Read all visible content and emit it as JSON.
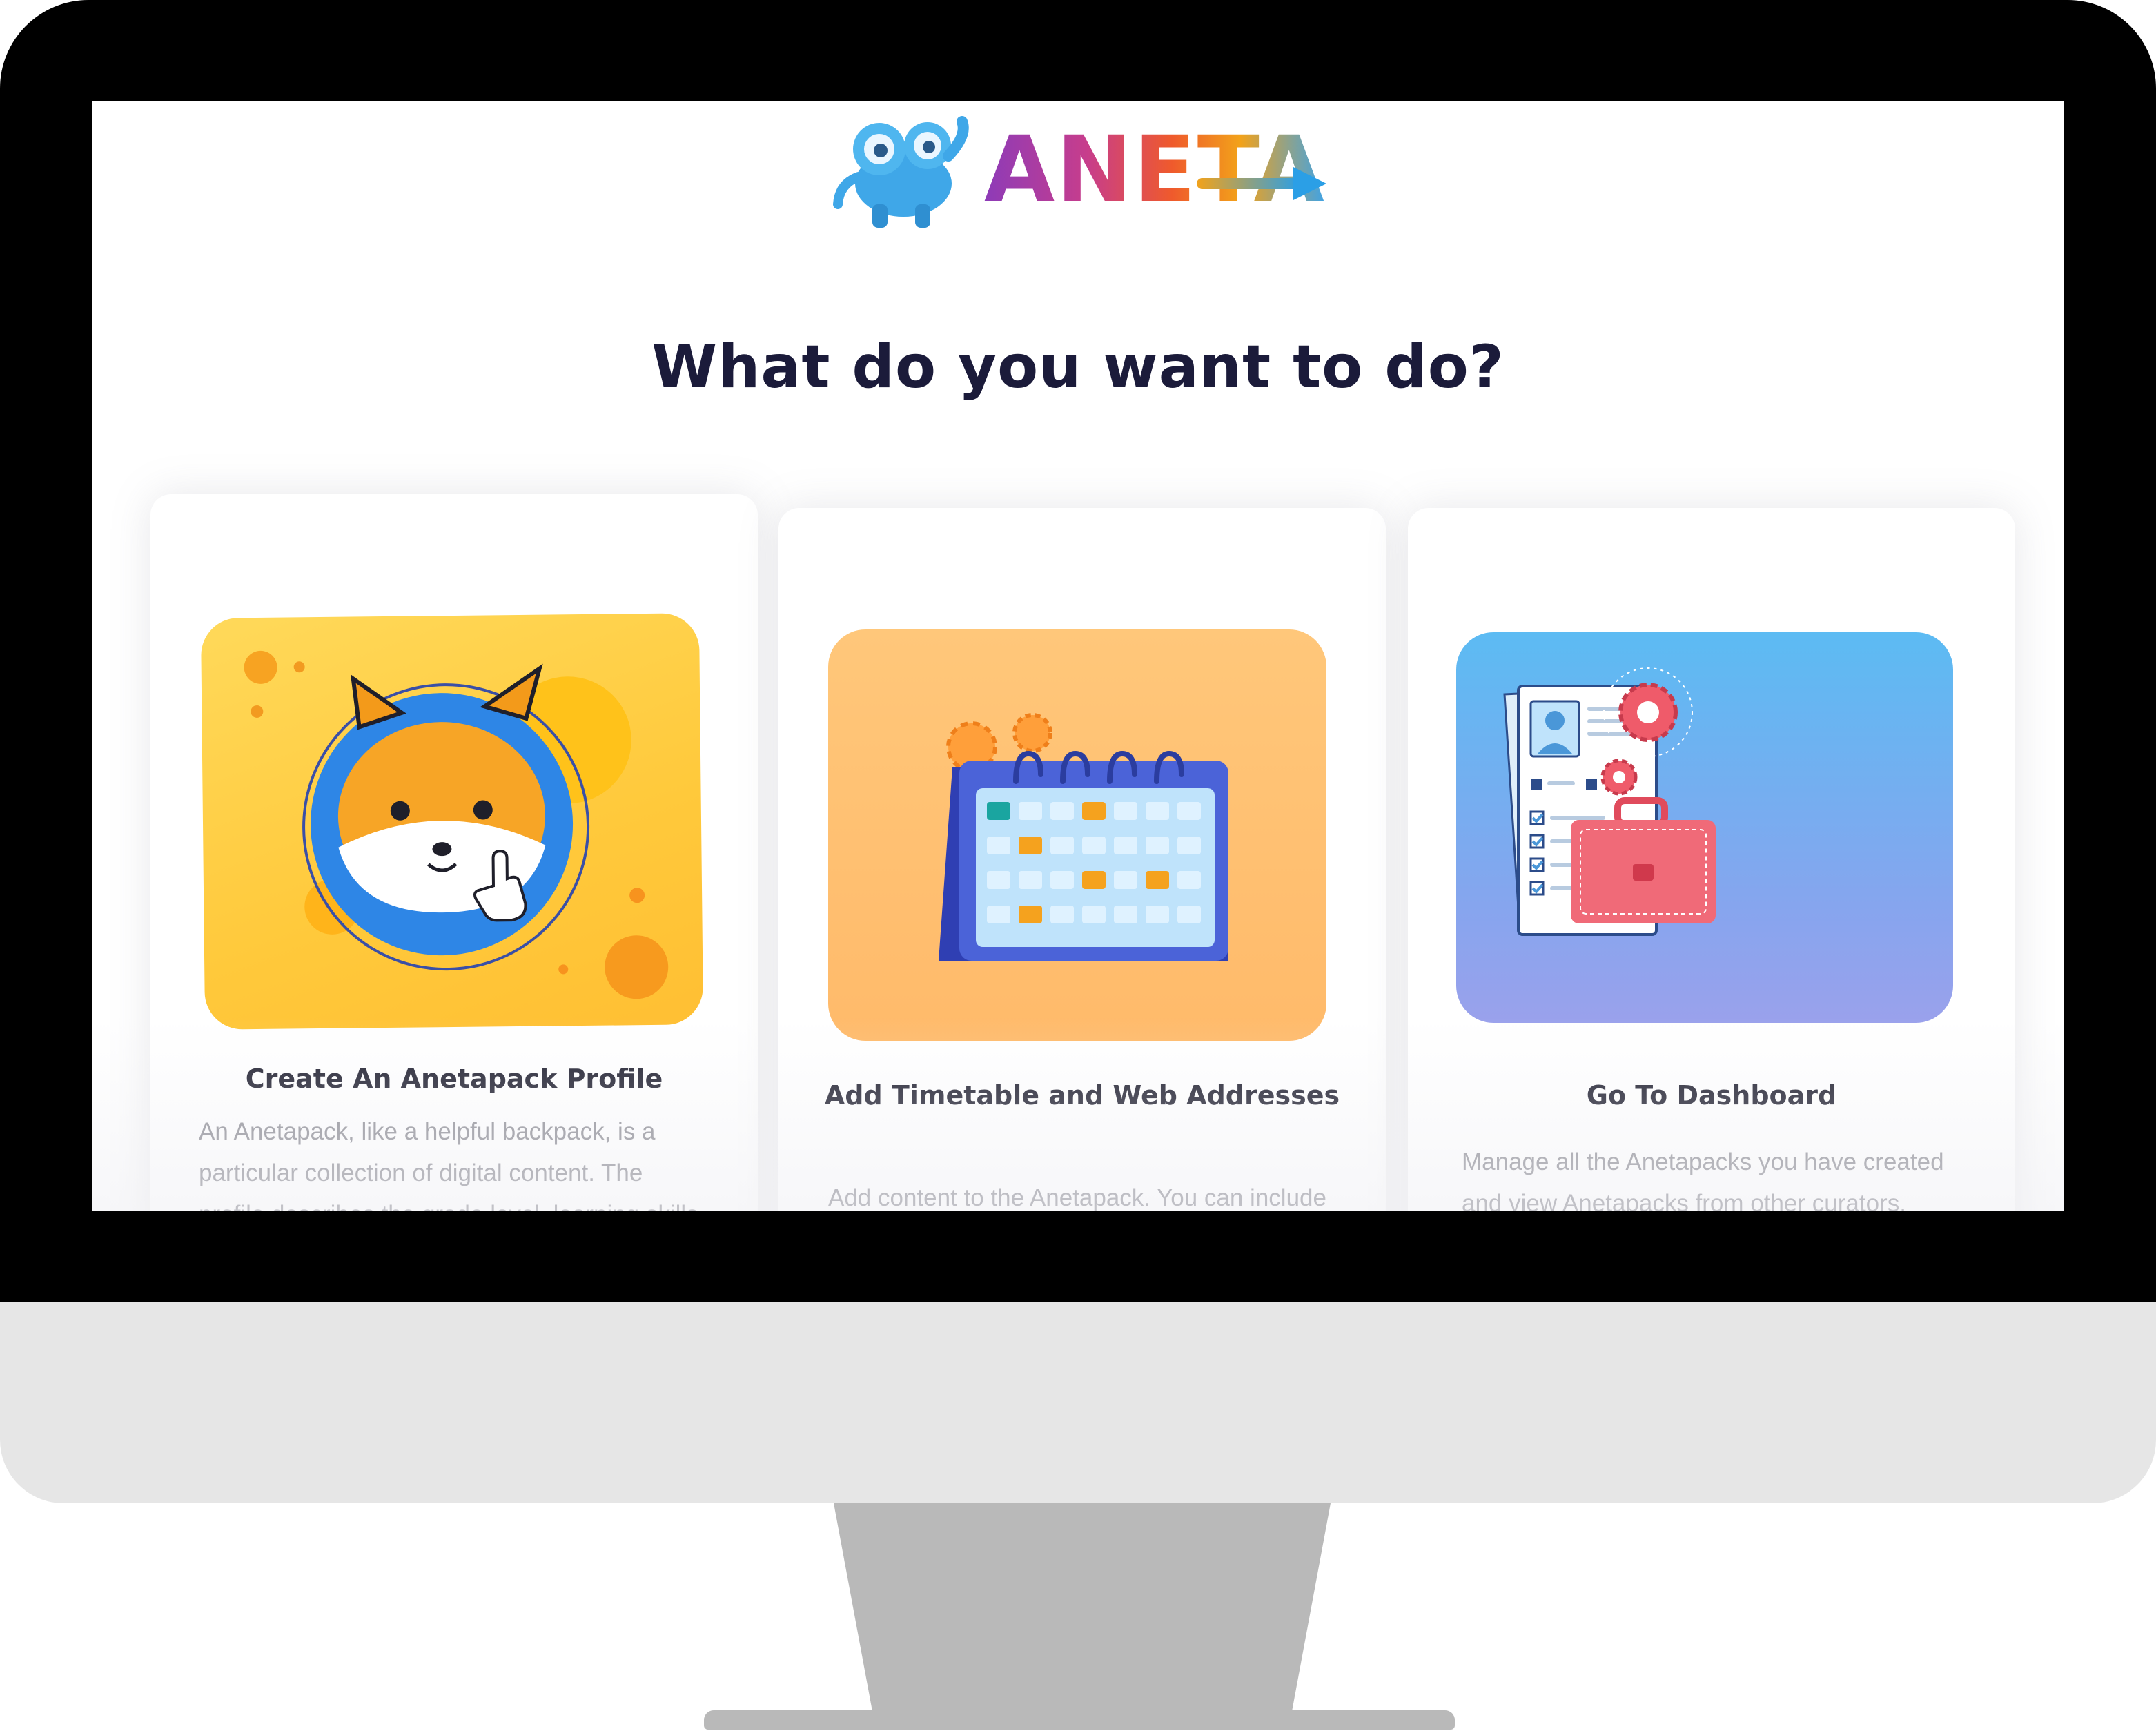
{
  "brand": {
    "logo_text": "ANETA"
  },
  "page": {
    "title": "What do you want to do?"
  },
  "cards": [
    {
      "title": "Create An Anetapack Profile",
      "description": "An Anetapack, like a helpful backpack, is a particular collection of digital content. The profile describes the grade level, learning skills and interests it covers.",
      "illustration": "fox-avatar-icon",
      "color": "#ffcf45"
    },
    {
      "title": "Add Timetable and Web Addresses",
      "description": "Add content to the Anetapack. You can include a schedule and web addresses that point to the digital content.",
      "illustration": "calendar-icon",
      "color": "#ffbe6f"
    },
    {
      "title": "Go To Dashboard",
      "description": "Manage all the Anetapacks you have created and view Anetapacks from other curators.",
      "illustration": "dashboard-briefcase-icon",
      "color": "#6fb3f2"
    }
  ],
  "colors": {
    "title": "#1b1b3a",
    "bezel": "#000000",
    "chin": "#e6e6e6",
    "stand": "#b9b9b9"
  }
}
